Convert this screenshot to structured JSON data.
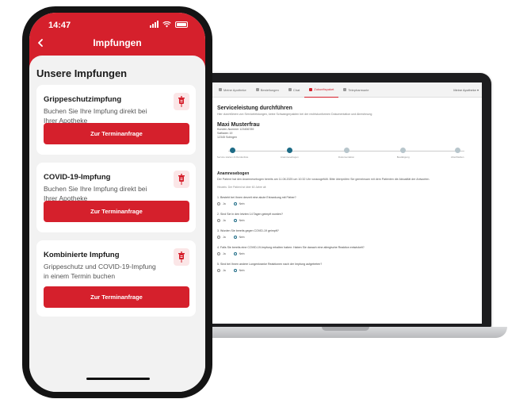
{
  "phone": {
    "status_time": "14:47",
    "header_title": "Impfungen",
    "section_heading": "Unsere Impfungen",
    "cards": [
      {
        "title": "Grippeschutzimpfung",
        "text": "Buchen Sie Ihre Impfung direkt bei Ihrer Apotheke",
        "button": "Zur Terminanfrage",
        "icon": "syringe-icon"
      },
      {
        "title": "COVID-19-Impfung",
        "text": "Buchen Sie Ihre Impfung direkt bei Ihrer Apotheke",
        "button": "Zur Terminanfrage",
        "icon": "syringe-icon"
      },
      {
        "title": "Kombinierte Impfung",
        "text": "Grippeschutz und COVID-19-Impfung in einem Termin buchen",
        "button": "Zur Terminanfrage",
        "icon": "syringe-icon"
      }
    ]
  },
  "laptop": {
    "tabs": [
      "Meine Apotheke",
      "Bestellungen",
      "Chat",
      "Zukunftspaket",
      "Telepharmazie"
    ],
    "active_tab_index": 3,
    "user": "Meine Apotheke ▾",
    "page_title": "Serviceleistung durchführen",
    "page_subtitle": "Hier durchführen von Serviceleistungen, keine Schwangerpakten bei der rechtskonformen Dokumentation und Abrechnung",
    "patient_name": "Maxi Musterfrau",
    "patient_lines": [
      "Kunden-Nummer 123456789",
      "Saffaden 19",
      "12345 Solingen"
    ],
    "steps": [
      {
        "label": "Service starten & Rundenliste",
        "done": true
      },
      {
        "label": "Anamnesebogen",
        "done": true
      },
      {
        "label": "Dokumentation",
        "done": false
      },
      {
        "label": "Bestätigung",
        "done": false
      },
      {
        "label": "Abschließen",
        "done": false
      }
    ],
    "section_title": "Anamnesebogen",
    "section_text": "Der Patient hat den Anamnesebogen bereits am 11.08.2025 um 10:32 Uhr vorausgefüllt. Bitte überprüfen Sie gemeinsam mit dem Patienten die Aktualität der Antworten.",
    "hint": "Hinweis: Der Patient ist über 60 Jahre alt",
    "questions": [
      {
        "text": "1. Besteht bei Ihnen derzeit eine akute Erkrankung mit Fieber?",
        "yes": "Ja",
        "no": "Nein"
      },
      {
        "text": "2. Sind Sie in den letzten 14 Tagen geimpft worden?",
        "yes": "Ja",
        "no": "Nein"
      },
      {
        "text": "3. Wurden Sie bereits gegen COVID-19 geimpft?",
        "yes": "Ja",
        "no": "Nein"
      },
      {
        "text": "4. Falls Sie bereits eine COVID-19-Impfung erhalten haben: Haben Sie danach eine allergische Reaktion entwickelt?",
        "yes": "Ja",
        "no": "Nein"
      },
      {
        "text": "5. Sind bei Ihnen andere Lungenkranke Reaktionen nach der Impfung aufgetreten?",
        "yes": "Ja",
        "no": "Nein"
      }
    ]
  },
  "colors": {
    "brand_red": "#d5202c",
    "teal": "#1d6b86"
  }
}
